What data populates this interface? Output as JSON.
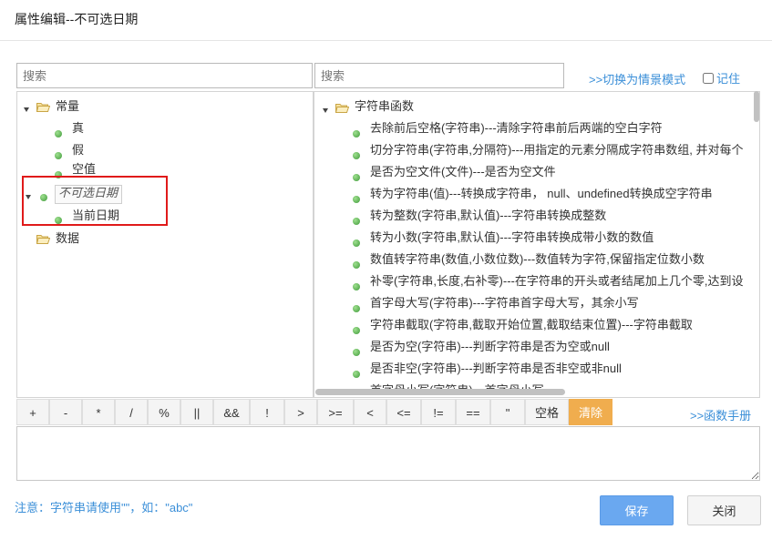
{
  "dialog": {
    "title": "属性编辑--不可选日期"
  },
  "left_search": {
    "placeholder": "搜索"
  },
  "right_search": {
    "placeholder": "搜索"
  },
  "switch_link": ">>切换为情景模式",
  "remember_label": "记住",
  "left_tree": {
    "constants": {
      "label": "常量",
      "children": [
        "真",
        "假",
        "空值"
      ]
    },
    "selected": {
      "label": "不可选日期",
      "children": [
        "当前日期"
      ]
    },
    "data": {
      "label": "数据"
    }
  },
  "right_tree": {
    "root": "字符串函数",
    "items": [
      "去除前后空格(字符串)---清除字符串前后两端的空白字符",
      "切分字符串(字符串,分隔符)---用指定的元素分隔成字符串数组, 并对每个",
      "是否为空文件(文件)---是否为空文件",
      "转为字符串(值)---转换成字符串， null、undefined转换成空字符串",
      "转为整数(字符串,默认值)---字符串转换成整数",
      "转为小数(字符串,默认值)---字符串转换成带小数的数值",
      "数值转字符串(数值,小数位数)---数值转为字符,保留指定位数小数",
      "补零(字符串,长度,右补零)---在字符串的开头或者结尾加上几个零,达到设",
      "首字母大写(字符串)---字符串首字母大写，其余小写",
      "字符串截取(字符串,截取开始位置,截取结束位置)---字符串截取",
      "是否为空(字符串)---判断字符串是否为空或null",
      "是否非空(字符串)---判断字符串是否非空或非null",
      "首字母小写(字符串)---首字母小写"
    ]
  },
  "operators": [
    "+",
    "-",
    "*",
    "/",
    "%",
    "||",
    "&&",
    "!",
    ">",
    ">=",
    "<",
    "<=",
    "!=",
    "==",
    "\"",
    "空格",
    "清除"
  ],
  "manual_link": ">>函数手册",
  "expression": {
    "value": ""
  },
  "note": "注意：字符串请使用\"\"，如：\"abc\"",
  "buttons": {
    "save": "保存",
    "close": "关闭"
  },
  "colors": {
    "accent": "#3b8fd8",
    "save": "#6aa8f0",
    "clear": "#f0ad4e",
    "highlight": "#e01a1a"
  }
}
